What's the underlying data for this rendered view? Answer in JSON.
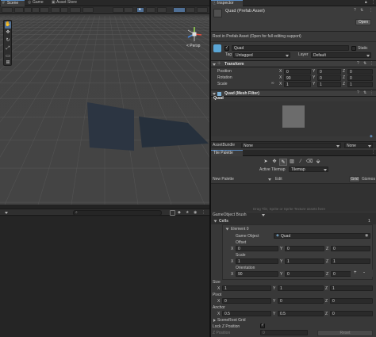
{
  "scene_window": {
    "tabs": [
      {
        "label": "Scene"
      },
      {
        "label": "Game"
      },
      {
        "label": "Asset Store"
      }
    ],
    "gizmo_label": "< Persp",
    "scene_tools": [
      "hand-tool",
      "move-tool",
      "rotate-tool",
      "scale-tool",
      "rect-tool",
      "transform-tool"
    ]
  },
  "inspector": {
    "tab_label": "Inspector",
    "asset_title": "Quad (Prefab Asset)",
    "open_label": "Open",
    "root_msg": "Root in Prefab Asset (Open for full editing support)",
    "object_name": "Quad",
    "static_label": "Static",
    "tag_label": "Tag",
    "tag_value": "Untagged",
    "layer_label": "Layer",
    "layer_value": "Default",
    "transform": {
      "title": "Transform",
      "position_label": "Position",
      "rotation_label": "Rotation",
      "scale_label": "Scale",
      "position": {
        "x": "0",
        "y": "0",
        "z": "0"
      },
      "rotation": {
        "x": "90",
        "y": "0",
        "z": "0"
      },
      "scale": {
        "x": "1",
        "y": "1",
        "z": "1"
      },
      "axis_x": "X",
      "axis_y": "Y",
      "axis_z": "Z"
    },
    "mesh_filter": {
      "title": "Quad (Mesh Filter)",
      "mesh_name": "Quad"
    },
    "asset_bundle_label": "AssetBundle",
    "asset_bundle_value": "None",
    "asset_bundle_variant": "None"
  },
  "tile_palette": {
    "title": "Tile Palette",
    "active_tilemap_label": "Active Tilemap",
    "active_tilemap_value": "Tilemap",
    "palette_value": "New Palette",
    "edit_label": "Edit",
    "grid_label": "Grid",
    "gizmos_label": "Gizmos",
    "drag_hint": "Drag Tile, Sprite or Sprite Texture assets here",
    "brush_label": "GameObject Brush",
    "cells_label": "Cells",
    "cells_count": "1",
    "element_label": "Element 0",
    "game_object_label": "Game Object",
    "game_object_value": "Quad",
    "offset_label": "Offset",
    "scale_label": "Scale",
    "orientation_label": "Orientation",
    "offset": {
      "x": "0",
      "y": "0",
      "z": "0"
    },
    "scale": {
      "x": "1",
      "y": "1",
      "z": "1"
    },
    "orientation": {
      "x": "90",
      "y": "0",
      "z": "0"
    },
    "size_label": "Size",
    "size": {
      "x": "1",
      "y": "1",
      "z": "1"
    },
    "pivot_label": "Pivot",
    "pivot": {
      "x": "0",
      "y": "0",
      "z": "0"
    },
    "anchor_label": "Anchor",
    "anchor": {
      "x": "0.5",
      "y": "0.5",
      "z": "0"
    },
    "scene_root_label": "SceneRoot Grid",
    "lock_z_label": "Lock Z Position",
    "z_position_label": "Z Position",
    "z_position_value": "0",
    "reset_label": "Reset",
    "plus_label": "+",
    "minus_label": "-"
  },
  "colors": {
    "accent": "#4f6f95",
    "panel": "#383838",
    "field": "#2a2a2a"
  }
}
